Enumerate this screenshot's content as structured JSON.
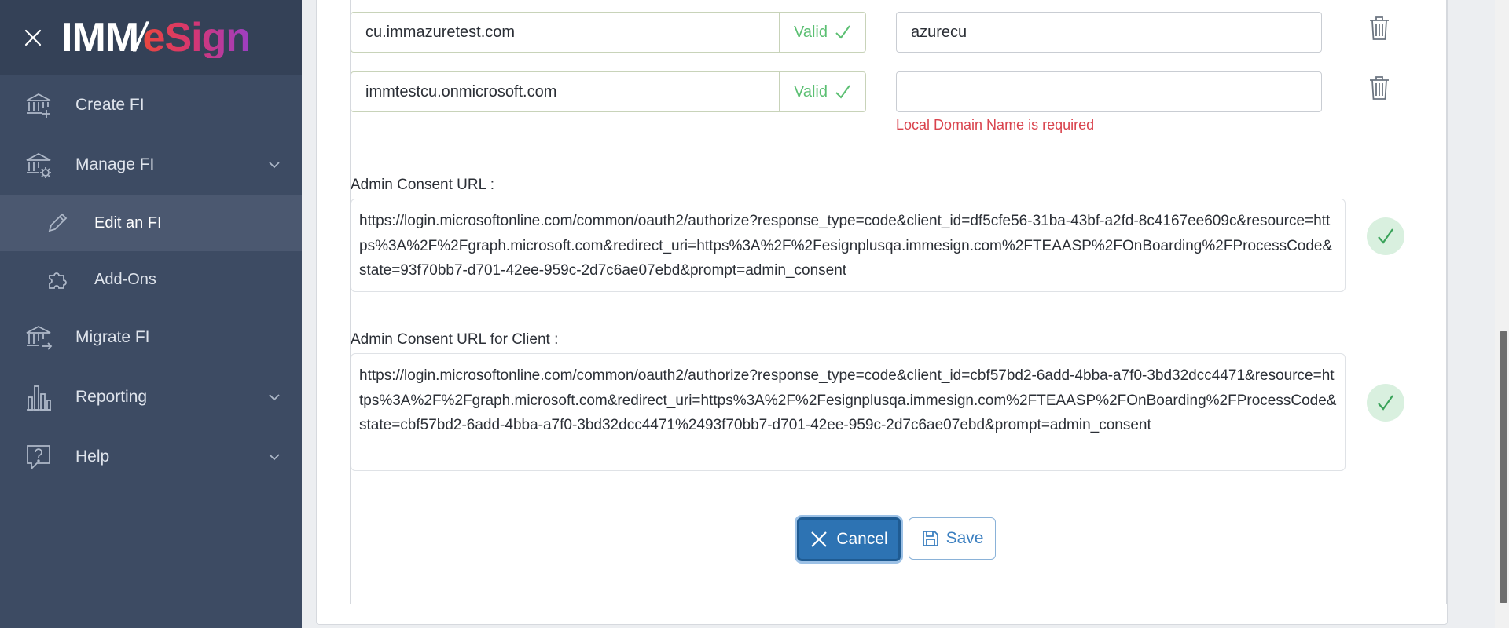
{
  "app": {
    "logo_imm": "IMM",
    "logo_slash": "/",
    "logo_esign": "eSign"
  },
  "sidebar": {
    "items": [
      {
        "label": "Create FI",
        "icon": "bank-plus-icon"
      },
      {
        "label": "Manage FI",
        "icon": "bank-gear-icon"
      },
      {
        "label": "Edit an FI",
        "icon": "pencil-icon"
      },
      {
        "label": "Add-Ons",
        "icon": "puzzle-icon"
      },
      {
        "label": "Migrate FI",
        "icon": "bank-arrow-icon"
      },
      {
        "label": "Reporting",
        "icon": "bar-chart-icon"
      },
      {
        "label": "Help",
        "icon": "question-bubble-icon"
      }
    ]
  },
  "domains": [
    {
      "domain": "cu.immazuretest.com",
      "status": "Valid",
      "local": "azurecu",
      "error": ""
    },
    {
      "domain": "immtestcu.onmicrosoft.com",
      "status": "Valid",
      "local": "",
      "error": "Local Domain Name is required"
    }
  ],
  "admin_consent": {
    "label": "Admin Consent URL :",
    "url": "https://login.microsoftonline.com/common/oauth2/authorize?response_type=code&client_id=df5cfe56-31ba-43bf-a2fd-8c4167ee609c&resource=https%3A%2F%2Fgraph.microsoft.com&redirect_uri=https%3A%2F%2Fesignplusqa.immesign.com%2FTEAASP%2FOnBoarding%2FProcessCode&state=93f70bb7-d701-42ee-959c-2d7c6ae07ebd&prompt=admin_consent"
  },
  "admin_consent_client": {
    "label": "Admin Consent URL for Client :",
    "url": "https://login.microsoftonline.com/common/oauth2/authorize?response_type=code&client_id=cbf57bd2-6add-4bba-a7f0-3bd32dcc4471&resource=https%3A%2F%2Fgraph.microsoft.com&redirect_uri=https%3A%2F%2Fesignplusqa.immesign.com%2FTEAASP%2FOnBoarding%2FProcessCode&state=cbf57bd2-6add-4bba-a7f0-3bd32dcc4471%2493f70bb7-d701-42ee-959c-2d7c6ae07ebd&prompt=admin_consent"
  },
  "buttons": {
    "cancel": "Cancel",
    "save": "Save"
  },
  "colors": {
    "sidebar_bg": "#3d4b63",
    "valid_green": "#5bbf72",
    "error_red": "#d9434d",
    "primary_blue": "#2d73b3"
  }
}
